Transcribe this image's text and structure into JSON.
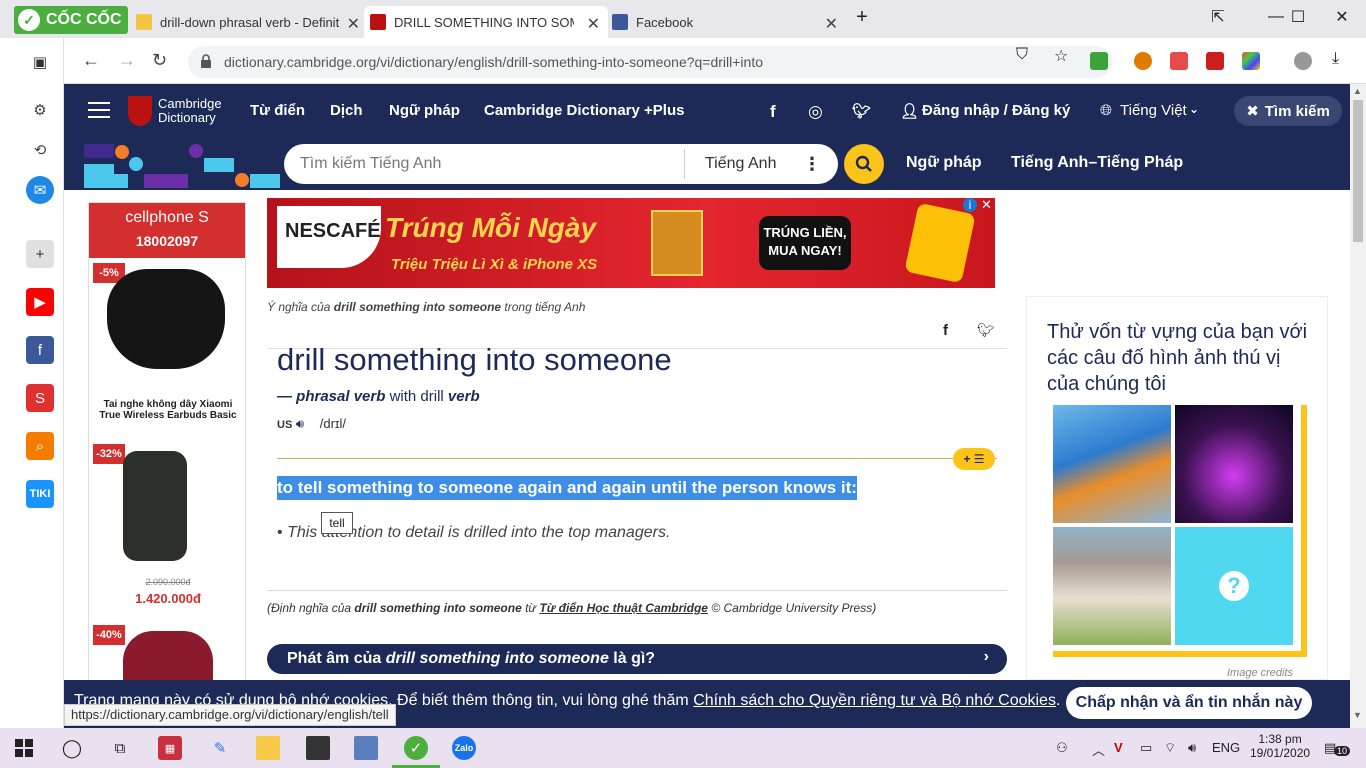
{
  "browser": {
    "brand": "CỐC CỐC",
    "tabs": [
      {
        "title": "drill-down phrasal verb - Definitio"
      },
      {
        "title": "DRILL SOMETHING INTO SOMEON"
      },
      {
        "title": "Facebook"
      }
    ],
    "url": "dictionary.cambridge.org/vi/dictionary/english/drill-something-into-someone?q=drill+into",
    "status_url": "https://dictionary.cambridge.org/vi/dictionary/english/tell"
  },
  "header": {
    "logo_line1": "Cambridge",
    "logo_line2": "Dictionary",
    "nav": [
      "Từ điển",
      "Dịch",
      "Ngữ pháp",
      "Cambridge Dictionary +Plus"
    ],
    "login": "Đăng nhập / Đăng ký",
    "language": "Tiếng Việt",
    "search_button": "Tìm kiếm"
  },
  "search": {
    "placeholder": "Tìm kiếm Tiếng Anh",
    "dictionary": "Tiếng Anh",
    "links": [
      "Ngữ pháp",
      "Tiếng Anh–Tiếng Pháp"
    ]
  },
  "left_ad": {
    "brand": "cellphone S",
    "hotline": "18002097",
    "products": [
      {
        "discount": "-5%",
        "name": "Tai nghe không dây Xiaomi True Wireless Earbuds Basic"
      },
      {
        "discount": "-32%",
        "old_price": "2.090.000đ",
        "price": "1.420.000đ"
      },
      {
        "discount": "-40%"
      }
    ]
  },
  "banner": {
    "brand": "NESCAFÉ",
    "title": "Trúng Mỗi Ngày",
    "subtitle": "Triệu Triệu Lì Xì & iPhone XS",
    "cta_line1": "TRÚNG LIỀN,",
    "cta_line2": "MUA NGAY!"
  },
  "entry": {
    "crumb_prefix": "Ý nghĩa của",
    "crumb_term": "drill something into someone",
    "crumb_suffix": "trong tiếng Anh",
    "headword": "drill something into someone",
    "pos_dash": "—",
    "pos": "phrasal verb",
    "with": "with drill",
    "verb": "verb",
    "region": "US",
    "ipa": "/drɪl/",
    "definition": "to tell something to someone again and again until the person knows it:",
    "tooltip": "tell",
    "example": "This attention to detail is drilled into the top managers.",
    "source_prefix": "(Định nghĩa của",
    "source_term": "drill something into someone",
    "source_mid": "từ",
    "source_link": "Từ điển Học thuật Cambridge",
    "source_suffix": "© Cambridge University Press)",
    "pron_prefix": "Phát âm của",
    "pron_term": "drill something into someone",
    "pron_suffix": "là gì?"
  },
  "quiz": {
    "title": "Thử vốn từ vựng của bạn với các câu đố hình ảnh thú vị của chúng tôi",
    "credits": "Image credits"
  },
  "cookie": {
    "text": "Trang mạng này có sử dụng bộ nhớ cookies. Để biết thêm thông tin, vui lòng ghé thăm",
    "link": "Chính sách cho Quyền riêng tư và Bộ nhớ Cookies",
    "button": "Chấp nhận và ẩn tin nhắn này"
  },
  "taskbar": {
    "lang": "ENG",
    "time": "1:38 pm",
    "date": "19/01/2020",
    "notif_count": "10"
  },
  "colors": {
    "cambridge_navy": "#1d2a57",
    "cambridge_yellow": "#fcc418",
    "highlight": "#3e8ee8",
    "coccoc_green": "#4cae3f"
  }
}
